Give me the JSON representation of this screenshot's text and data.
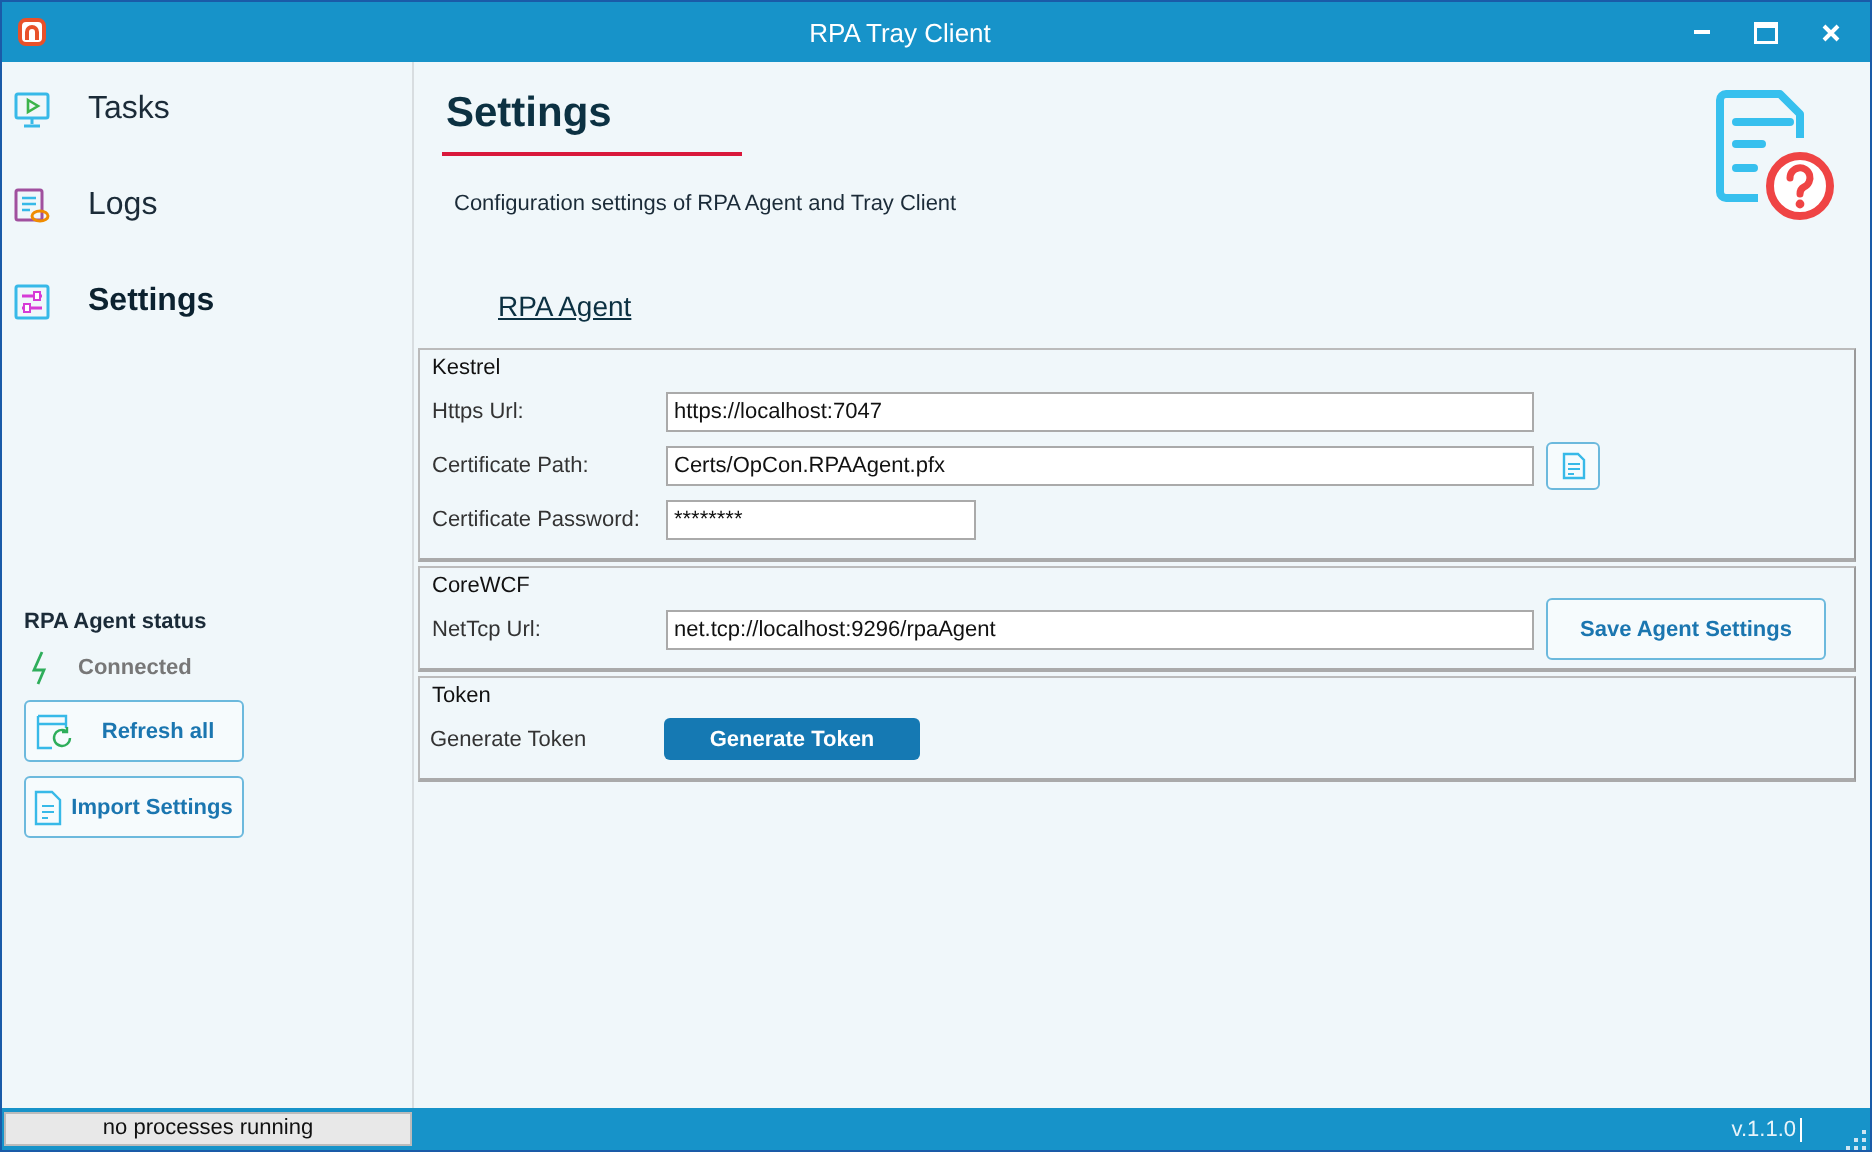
{
  "window": {
    "title": "RPA Tray Client"
  },
  "sidebar": {
    "items": [
      {
        "label": "Tasks",
        "selected": false
      },
      {
        "label": "Logs",
        "selected": false
      },
      {
        "label": "Settings",
        "selected": true
      }
    ],
    "status": {
      "title": "RPA Agent status",
      "state": "Connected"
    },
    "buttons": [
      "Refresh all",
      "Import Settings"
    ]
  },
  "page": {
    "title": "Settings",
    "description": "Configuration settings of RPA Agent and Tray Client",
    "section_link": "RPA Agent",
    "groups": [
      {
        "title": "Kestrel",
        "rows": [
          {
            "kind": "text",
            "label": "Https Url:",
            "value": "https://localhost:7047"
          },
          {
            "kind": "file",
            "label": "Certificate Path:",
            "value": "Certs/OpCon.RPAAgent.pfx"
          },
          {
            "kind": "password",
            "label": "Certificate Password:",
            "value": "********"
          }
        ]
      },
      {
        "title": "CoreWCF",
        "rows": [
          {
            "kind": "text",
            "label": "NetTcp Url:",
            "value": "net.tcp://localhost:9296/rpaAgent",
            "button": "Save Agent Settings"
          }
        ]
      },
      {
        "title": "Token",
        "rows": [
          {
            "kind": "action",
            "label": "Generate Token",
            "button": "Generate Token"
          }
        ]
      }
    ]
  },
  "status_bar": {
    "message": "no processes running",
    "version": "v.1.1.0"
  }
}
